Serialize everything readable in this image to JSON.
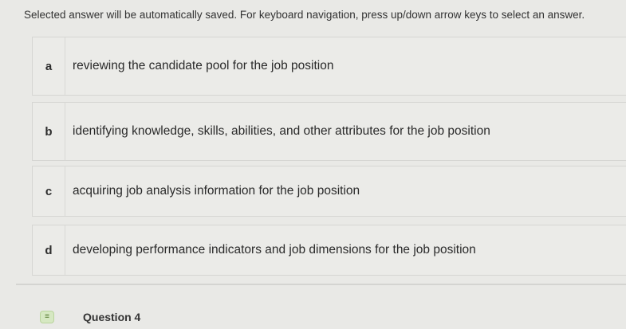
{
  "instructions": "Selected answer will be automatically saved. For keyboard navigation, press up/down arrow keys to select an answer.",
  "choices": [
    {
      "letter": "a",
      "text": "reviewing the candidate pool for the job position"
    },
    {
      "letter": "b",
      "text": "identifying knowledge, skills, abilities, and other attributes for the job position"
    },
    {
      "letter": "c",
      "text": "acquiring job analysis information for the job position"
    },
    {
      "letter": "d",
      "text": "developing performance indicators and job dimensions for the job position"
    }
  ],
  "next_question": {
    "icon": "list-icon",
    "icon_glyph": "≡",
    "title": "Question 4"
  }
}
